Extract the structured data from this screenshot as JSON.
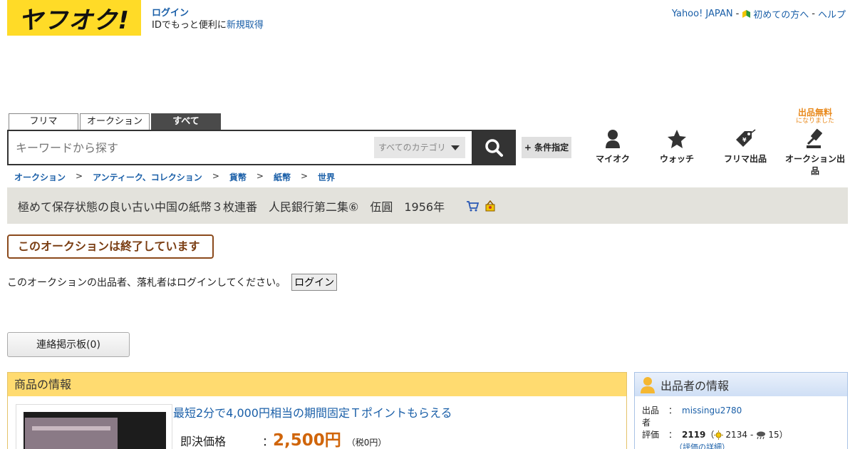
{
  "header": {
    "logo_text": "ヤフオク!",
    "login_link": "ログイン",
    "login_sub_text": "IDでもっと便利に",
    "register_link": "新規取得",
    "yahoo_japan": "Yahoo! JAPAN",
    "beginner": "初めての方へ",
    "help": "ヘルプ",
    "separator": "-"
  },
  "search": {
    "tabs": [
      {
        "label": "フリマ"
      },
      {
        "label": "オークション"
      },
      {
        "label": "すべて"
      }
    ],
    "placeholder": "キーワードから探す",
    "category": "すべてのカテゴリ",
    "condition_button": "+ 条件指定"
  },
  "nav": {
    "myauc": "マイオク",
    "watch": "ウォッチ",
    "flea_sell": "フリマ出品",
    "auction_sell": "オークション出品",
    "free_banner": "出品無料",
    "free_banner_sub": "になりました"
  },
  "breadcrumb": [
    {
      "label": "オークション"
    },
    {
      "label": "アンティーク、コレクション"
    },
    {
      "label": "貨幣"
    },
    {
      "label": "紙幣"
    },
    {
      "label": "世界"
    }
  ],
  "breadcrumb_sep": ">",
  "item": {
    "title": "極めて保存状態の良い古い中国の紙幣３枚連番　人民銀行第二集⑥　伍圓　1956年",
    "ended_message": "このオークションは終了しています",
    "login_notice": "このオークションの出品者、落札者はログインしてください。",
    "login_button": "ログイン",
    "board_button": "連絡掲示板(0)"
  },
  "item_panel": {
    "header": "商品の情報",
    "promo": "最短2分で4,000円相当の期間固定Ｔポイントもらえる",
    "buyout_label": "即決価格",
    "colon": "：",
    "price": "2,500円",
    "tax": "（税0円）"
  },
  "seller_panel": {
    "header": "出品者の情報",
    "seller_label": "出品者",
    "seller_name": "missingu2780",
    "rating_label": "評価",
    "colon": "：",
    "rating": "2119",
    "rating_open": "（",
    "good": "2134",
    "dash": "-",
    "bad": "15",
    "rating_close": "）",
    "rating_detail": "（評価の詳細）"
  },
  "colors": {
    "logo_bg": "#ffdb27",
    "link": "#1a5fa8",
    "price": "#d0650a",
    "item_header": "#ffdb70",
    "ended_border": "#8b4a1c"
  }
}
